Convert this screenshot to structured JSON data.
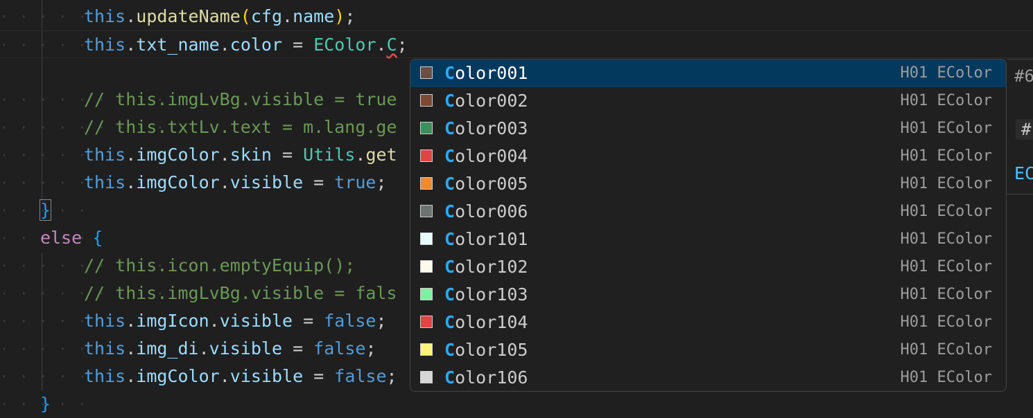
{
  "editor": {
    "lines": [
      {
        "ws": "· · · · · · · · ·",
        "parts": [
          [
            "kw",
            "this"
          ],
          [
            "pn",
            "."
          ],
          [
            "fn",
            "updateName"
          ],
          [
            "par",
            "("
          ],
          [
            "prop",
            "cfg"
          ],
          [
            "pn",
            "."
          ],
          [
            "prop",
            "name"
          ],
          [
            "par",
            ")"
          ],
          [
            "pn",
            ";"
          ]
        ]
      },
      {
        "ws": "· · · · · · · · ·",
        "parts": [
          [
            "kw",
            "this"
          ],
          [
            "pn",
            "."
          ],
          [
            "prop",
            "txt_name"
          ],
          [
            "pn",
            "."
          ],
          [
            "prop",
            "color"
          ],
          [
            "pn",
            " = "
          ],
          [
            "cls",
            "EColor"
          ],
          [
            "pn",
            "."
          ],
          [
            "squig",
            "C"
          ],
          [
            "pn",
            ";"
          ]
        ]
      },
      {
        "ws": "",
        "parts": []
      },
      {
        "ws": "· · · · · · · · ·",
        "parts": [
          [
            "cmt",
            "// this.imgLvBg.visible = true"
          ]
        ]
      },
      {
        "ws": "· · · · · · · · ·",
        "parts": [
          [
            "cmt",
            "// this.txtLv.text = m.lang.ge"
          ]
        ]
      },
      {
        "ws": "· · · · · · · · ·",
        "parts": [
          [
            "kw",
            "this"
          ],
          [
            "pn",
            "."
          ],
          [
            "prop",
            "imgColor"
          ],
          [
            "pn",
            "."
          ],
          [
            "prop",
            "skin"
          ],
          [
            "pn",
            " = "
          ],
          [
            "cls",
            "Utils"
          ],
          [
            "pn",
            "."
          ],
          [
            "fn",
            "get"
          ]
        ]
      },
      {
        "ws": "· · · · · · · · ·",
        "parts": [
          [
            "kw",
            "this"
          ],
          [
            "pn",
            "."
          ],
          [
            "prop",
            "imgColor"
          ],
          [
            "pn",
            "."
          ],
          [
            "prop",
            "visible"
          ],
          [
            "pn",
            " = "
          ],
          [
            "kw",
            "true"
          ],
          [
            "pn",
            ";"
          ]
        ]
      },
      {
        "ws": "· · · · ·",
        "parts": [
          [
            "brace",
            "}"
          ]
        ]
      },
      {
        "ws": "· · · · ·",
        "parts": [
          [
            "kw2",
            "else"
          ],
          [
            "pn",
            " "
          ],
          [
            "brace",
            "{"
          ]
        ]
      },
      {
        "ws": "· · · · · · · · ·",
        "parts": [
          [
            "cmt",
            "// this.icon.emptyEquip();"
          ]
        ]
      },
      {
        "ws": "· · · · · · · · ·",
        "parts": [
          [
            "cmt",
            "// this.imgLvBg.visible = fals"
          ]
        ]
      },
      {
        "ws": "· · · · · · · · ·",
        "parts": [
          [
            "kw",
            "this"
          ],
          [
            "pn",
            "."
          ],
          [
            "prop",
            "imgIcon"
          ],
          [
            "pn",
            "."
          ],
          [
            "prop",
            "visible"
          ],
          [
            "pn",
            " = "
          ],
          [
            "kw",
            "false"
          ],
          [
            "pn",
            ";"
          ]
        ]
      },
      {
        "ws": "· · · · · · · · ·",
        "parts": [
          [
            "kw",
            "this"
          ],
          [
            "pn",
            "."
          ],
          [
            "prop",
            "img_di"
          ],
          [
            "pn",
            "."
          ],
          [
            "prop",
            "visible"
          ],
          [
            "pn",
            " = "
          ],
          [
            "kw",
            "false"
          ],
          [
            "pn",
            ";"
          ]
        ]
      },
      {
        "ws": "· · · · · · · · ·",
        "parts": [
          [
            "kw",
            "this"
          ],
          [
            "pn",
            "."
          ],
          [
            "prop",
            "imgColor"
          ],
          [
            "pn",
            "."
          ],
          [
            "prop",
            "visible"
          ],
          [
            "pn",
            " = "
          ],
          [
            "kw",
            "false"
          ],
          [
            "pn",
            ";"
          ]
        ]
      },
      {
        "ws": "· · · · ·",
        "parts": [
          [
            "brace",
            "}"
          ]
        ]
      }
    ]
  },
  "suggest": {
    "items": [
      {
        "match": "C",
        "rest": "olor001",
        "detail": "H01 EColor",
        "swatch": "#6b4f45"
      },
      {
        "match": "C",
        "rest": "olor002",
        "detail": "H01 EColor",
        "swatch": "#7a4a33"
      },
      {
        "match": "C",
        "rest": "olor003",
        "detail": "H01 EColor",
        "swatch": "#3b8f5a"
      },
      {
        "match": "C",
        "rest": "olor004",
        "detail": "H01 EColor",
        "swatch": "#e04444"
      },
      {
        "match": "C",
        "rest": "olor005",
        "detail": "H01 EColor",
        "swatch": "#f08a30"
      },
      {
        "match": "C",
        "rest": "olor006",
        "detail": "H01 EColor",
        "swatch": "#6a7370"
      },
      {
        "match": "C",
        "rest": "olor101",
        "detail": "H01 EColor",
        "swatch": "#e6fbff"
      },
      {
        "match": "C",
        "rest": "olor102",
        "detail": "H01 EColor",
        "swatch": "#fff9ec"
      },
      {
        "match": "C",
        "rest": "olor103",
        "detail": "H01 EColor",
        "swatch": "#7ef0a0"
      },
      {
        "match": "C",
        "rest": "olor104",
        "detail": "H01 EColor",
        "swatch": "#e24343"
      },
      {
        "match": "C",
        "rest": "olor105",
        "detail": "H01 EColor",
        "swatch": "#fff27a"
      },
      {
        "match": "C",
        "rest": "olor106",
        "detail": "H01 EColor",
        "swatch": "#d6d6d6"
      }
    ],
    "selected_index": 0
  },
  "details": {
    "line1": "#6",
    "line2": "#",
    "line3": "EC"
  },
  "colors": {
    "background": "#1f1f1f",
    "selection": "#04395e",
    "match_highlight": "#2aaaff"
  }
}
